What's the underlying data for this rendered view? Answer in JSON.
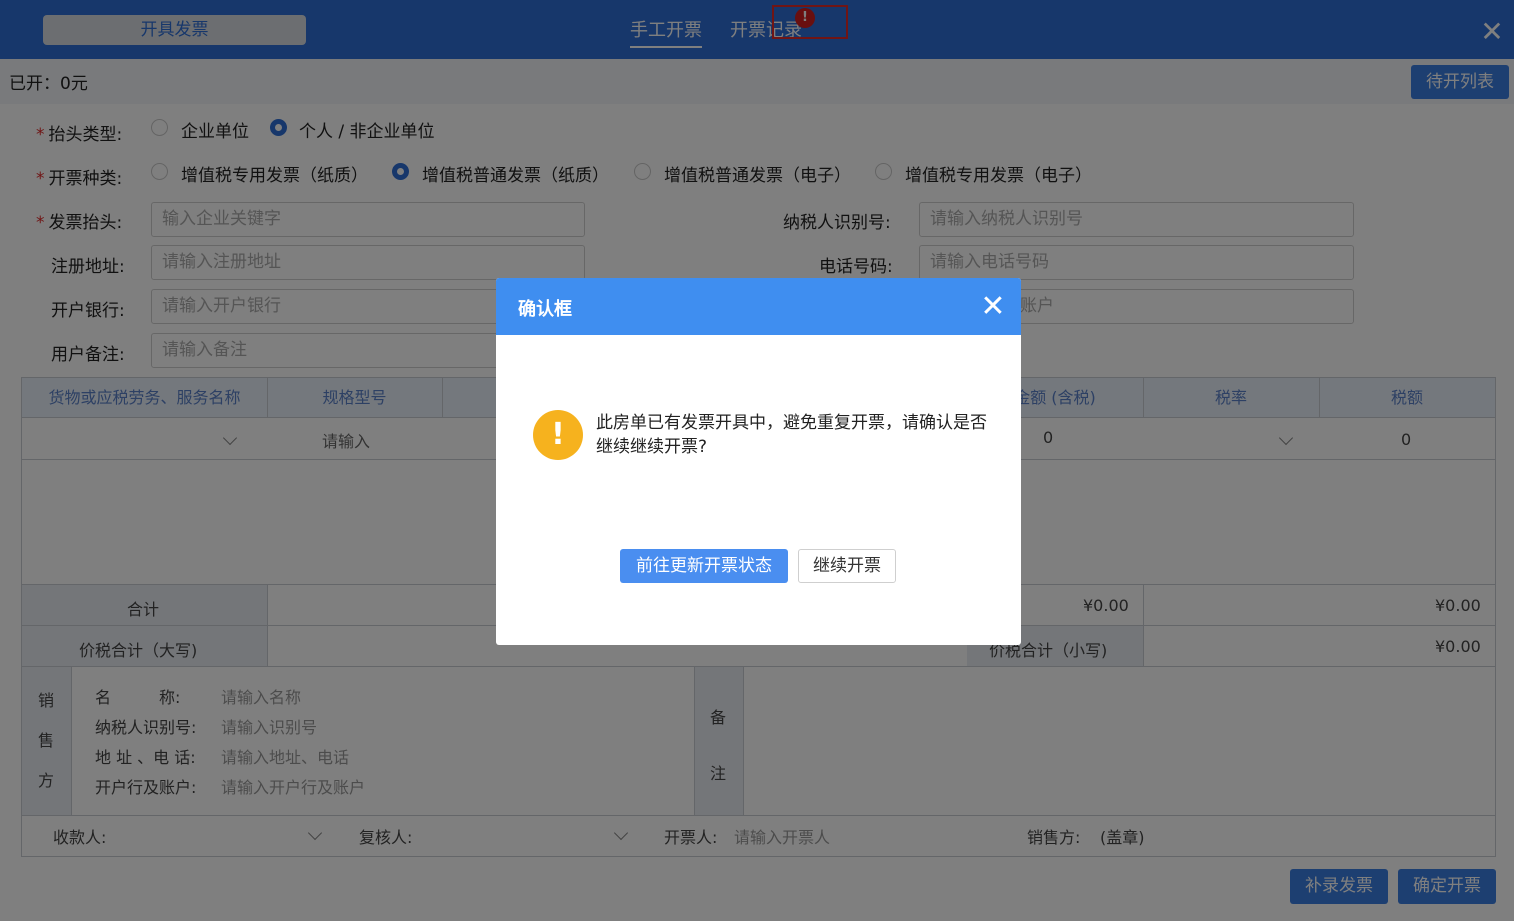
{
  "header": {
    "issue_tab": "开具发票",
    "tabs": [
      "手工开票",
      "开票记录"
    ],
    "alert_icon": "!",
    "close": "✕"
  },
  "summary": {
    "issued": "已开：0元",
    "pending_button": "待开列表"
  },
  "form": {
    "title_type_label": "抬头类型:",
    "title_type_options": [
      "企业单位",
      "个人 / 非企业单位"
    ],
    "title_type_selected": "个人 / 非企业单位",
    "invoice_kind_label": "开票种类:",
    "invoice_kind_options": [
      "增值税专用发票（纸质）",
      "增值税普通发票（纸质）",
      "增值税普通发票（电子）",
      "增值税专用发票（电子）"
    ],
    "invoice_kind_selected": "增值税普通发票（纸质）",
    "invoice_title_label": "发票抬头:",
    "invoice_title_placeholder": "输入企业关键字",
    "taxpayer_id_label": "纳税人识别号:",
    "taxpayer_id_placeholder": "请输入纳税人识别号",
    "reg_address_label": "注册地址:",
    "reg_address_placeholder": "请输入注册地址",
    "phone_label": "电话号码:",
    "phone_placeholder": "请输入电话号码",
    "bank_label": "开户银行:",
    "bank_placeholder": "请输入开户银行",
    "account_placeholder_partial": "账户",
    "remark_label": "用户备注:",
    "remark_placeholder": "请输入备注"
  },
  "table": {
    "headers": {
      "name": "货物或应税劳务、服务名称",
      "spec": "规格型号",
      "amount": "金额 (含税)",
      "rate": "税率",
      "tax": "税额"
    },
    "row": {
      "spec_placeholder": "请输入",
      "amount": "0",
      "tax": "0"
    },
    "total_label": "合计",
    "total_amount": "¥0.00",
    "total_tax": "¥0.00",
    "grand_total_upper_label": "价税合计（大写)",
    "grand_total_lower_label": "价税合计（小写)",
    "grand_total_lower": "¥0.00"
  },
  "seller": {
    "section_chars": [
      "销",
      "售",
      "方"
    ],
    "name_label": "名　　　称:",
    "name_placeholder": "请输入名称",
    "taxid_label": "纳税人识别号:",
    "taxid_placeholder": "请输入识别号",
    "address_label": "地 址 、电 话:",
    "address_placeholder": "请输入地址、电话",
    "bank_label": "开户行及账户:",
    "bank_placeholder": "请输入开户行及账户",
    "remark_chars": [
      "备",
      "注"
    ]
  },
  "footer": {
    "payee_label": "收款人:",
    "reviewer_label": "复核人:",
    "drawer_label": "开票人:",
    "drawer_placeholder": "请输入开票人",
    "seller_label": "销售方:",
    "seller_stamp": "(盖章)"
  },
  "actions": {
    "supplement": "补录发票",
    "confirm": "确定开票"
  },
  "modal": {
    "title": "确认框",
    "close": "✕",
    "icon": "!",
    "message": "此房单已有发票开具中，避免重复开票，请确认是否继续继续开票?",
    "primary_button": "前往更新开票状态",
    "secondary_button": "继续开票"
  },
  "colors": {
    "header_blue": "#2f6fd6",
    "modal_blue": "#3f8ef0",
    "warning": "#f6b21e",
    "alert_red": "#d21e1e"
  }
}
